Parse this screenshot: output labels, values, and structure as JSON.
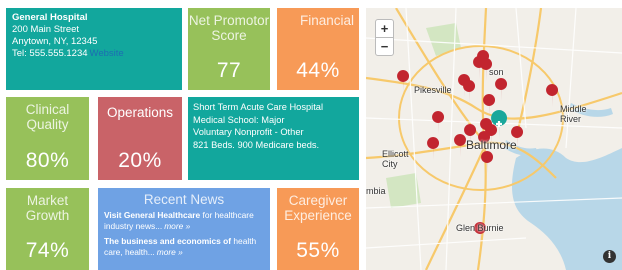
{
  "hospital": {
    "name": "General Hospital",
    "address_line1": "200 Main Street",
    "address_line2": "Anytown, NY, 12345",
    "tel": "Tel: 555.555.1234",
    "website_label": "Website"
  },
  "tiles": {
    "nps": {
      "label": "Net Promotor Score",
      "value": "77",
      "color": "#97c15a"
    },
    "financial": {
      "label": "Financial",
      "value": "44%",
      "color": "#f79a57"
    },
    "clinical_quality": {
      "label": "Clinical Quality",
      "value": "80%",
      "color": "#97c15a"
    },
    "operations": {
      "label": "Operations",
      "value": "20%",
      "color": "#c96368"
    },
    "market_growth": {
      "label": "Market Growth",
      "value": "74%",
      "color": "#97c15a"
    },
    "caregiver_experience": {
      "label": "Caregiver Experience",
      "value": "55%",
      "color": "#f79a57"
    }
  },
  "details": {
    "line1": "Short Term Acute Care Hospital",
    "line2": "Medical School: Major",
    "line3": "Voluntary Nonprofit - Other",
    "line4": "821 Beds. 900 Medicare beds."
  },
  "news": {
    "title": "Recent News",
    "items": [
      {
        "bold": "Visit General Healthcare",
        "text": " for healthcare industry news...",
        "more": "more »"
      },
      {
        "bold": "The business and economics of",
        "text": " health care, health...",
        "more": "more »"
      }
    ]
  },
  "map": {
    "zoom_in": "+",
    "zoom_out": "−",
    "places": {
      "pikesville": "Pikesville",
      "towson": "son",
      "middle_river": "Middle River",
      "ellicott_city": "Ellicott City",
      "baltimore": "Baltimore",
      "columbia": "mbia",
      "glen_burnie": "Glen Burnie"
    },
    "info_icon": "i",
    "colors": {
      "marker": "#c2252f",
      "hospital_marker": "#1aa79b",
      "water": "#b8d7e8"
    }
  }
}
